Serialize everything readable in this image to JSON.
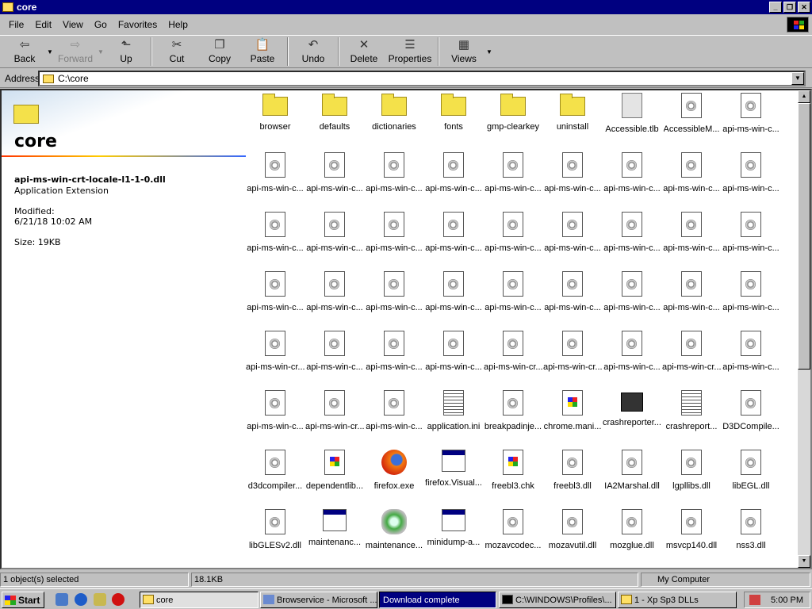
{
  "window": {
    "title": "core"
  },
  "menu": [
    "File",
    "Edit",
    "View",
    "Go",
    "Favorites",
    "Help"
  ],
  "toolbar": [
    {
      "label": "Back",
      "icon": "back-arrow-icon",
      "disabled": false
    },
    {
      "label": "Forward",
      "icon": "forward-arrow-icon",
      "disabled": true
    },
    {
      "label": "Up",
      "icon": "up-folder-icon",
      "disabled": false
    },
    {
      "label": "Cut",
      "icon": "scissors-icon",
      "disabled": false
    },
    {
      "label": "Copy",
      "icon": "copy-icon",
      "disabled": false
    },
    {
      "label": "Paste",
      "icon": "paste-icon",
      "disabled": false
    },
    {
      "label": "Undo",
      "icon": "undo-icon",
      "disabled": false
    },
    {
      "label": "Delete",
      "icon": "delete-icon",
      "disabled": false
    },
    {
      "label": "Properties",
      "icon": "properties-icon",
      "disabled": false
    },
    {
      "label": "Views",
      "icon": "views-icon",
      "disabled": false
    }
  ],
  "address": {
    "label": "Address",
    "value": "C:\\core"
  },
  "info_pane": {
    "folder_name": "core",
    "file_name": "api-ms-win-crt-locale-l1-1-0.dll",
    "file_type": "Application Extension",
    "modified_label": "Modified:",
    "modified_value": "6/21/18 10:02 AM",
    "size": "Size: 19KB"
  },
  "files": [
    {
      "name": "browser",
      "type": "folder"
    },
    {
      "name": "defaults",
      "type": "folder"
    },
    {
      "name": "dictionaries",
      "type": "folder"
    },
    {
      "name": "fonts",
      "type": "folder"
    },
    {
      "name": "gmp-clearkey",
      "type": "folder"
    },
    {
      "name": "uninstall",
      "type": "folder"
    },
    {
      "name": "Accessible.tlb",
      "type": "gen"
    },
    {
      "name": "AccessibleM...",
      "type": "dll"
    },
    {
      "name": "api-ms-win-c...",
      "type": "dll"
    },
    {
      "name": "api-ms-win-c...",
      "type": "dll"
    },
    {
      "name": "api-ms-win-c...",
      "type": "dll"
    },
    {
      "name": "api-ms-win-c...",
      "type": "dll"
    },
    {
      "name": "api-ms-win-c...",
      "type": "dll"
    },
    {
      "name": "api-ms-win-c...",
      "type": "dll"
    },
    {
      "name": "api-ms-win-c...",
      "type": "dll"
    },
    {
      "name": "api-ms-win-c...",
      "type": "dll"
    },
    {
      "name": "api-ms-win-c...",
      "type": "dll"
    },
    {
      "name": "api-ms-win-c...",
      "type": "dll"
    },
    {
      "name": "api-ms-win-c...",
      "type": "dll"
    },
    {
      "name": "api-ms-win-c...",
      "type": "dll"
    },
    {
      "name": "api-ms-win-c...",
      "type": "dll"
    },
    {
      "name": "api-ms-win-c...",
      "type": "dll"
    },
    {
      "name": "api-ms-win-c...",
      "type": "dll"
    },
    {
      "name": "api-ms-win-c...",
      "type": "dll"
    },
    {
      "name": "api-ms-win-c...",
      "type": "dll"
    },
    {
      "name": "api-ms-win-c...",
      "type": "dll"
    },
    {
      "name": "api-ms-win-c...",
      "type": "dll"
    },
    {
      "name": "api-ms-win-c...",
      "type": "dll"
    },
    {
      "name": "api-ms-win-c...",
      "type": "dll"
    },
    {
      "name": "api-ms-win-c...",
      "type": "dll"
    },
    {
      "name": "api-ms-win-c...",
      "type": "dll"
    },
    {
      "name": "api-ms-win-c...",
      "type": "dll"
    },
    {
      "name": "api-ms-win-c...",
      "type": "dll"
    },
    {
      "name": "api-ms-win-c...",
      "type": "dll"
    },
    {
      "name": "api-ms-win-c...",
      "type": "dll"
    },
    {
      "name": "api-ms-win-c...",
      "type": "dll"
    },
    {
      "name": "api-ms-win-cr...",
      "type": "dll"
    },
    {
      "name": "api-ms-win-c...",
      "type": "dll"
    },
    {
      "name": "api-ms-win-c...",
      "type": "dll"
    },
    {
      "name": "api-ms-win-c...",
      "type": "dll"
    },
    {
      "name": "api-ms-win-cr...",
      "type": "dll"
    },
    {
      "name": "api-ms-win-cr...",
      "type": "dll"
    },
    {
      "name": "api-ms-win-c...",
      "type": "dll"
    },
    {
      "name": "api-ms-win-cr...",
      "type": "dll"
    },
    {
      "name": "api-ms-win-c...",
      "type": "dll"
    },
    {
      "name": "api-ms-win-c...",
      "type": "dll"
    },
    {
      "name": "api-ms-win-cr...",
      "type": "dll"
    },
    {
      "name": "api-ms-win-c...",
      "type": "dll"
    },
    {
      "name": "application.ini",
      "type": "ini"
    },
    {
      "name": "breakpadinje...",
      "type": "dll"
    },
    {
      "name": "chrome.mani...",
      "type": "win"
    },
    {
      "name": "crashreporter...",
      "type": "crash"
    },
    {
      "name": "crashreport...",
      "type": "ini"
    },
    {
      "name": "D3DCompile...",
      "type": "dll"
    },
    {
      "name": "d3dcompiler...",
      "type": "dll"
    },
    {
      "name": "dependentlib...",
      "type": "win"
    },
    {
      "name": "firefox.exe",
      "type": "ff"
    },
    {
      "name": "firefox.Visual...",
      "type": "exe"
    },
    {
      "name": "freebl3.chk",
      "type": "win"
    },
    {
      "name": "freebl3.dll",
      "type": "dll"
    },
    {
      "name": "IA2Marshal.dll",
      "type": "dll"
    },
    {
      "name": "lgpllibs.dll",
      "type": "dll"
    },
    {
      "name": "libEGL.dll",
      "type": "dll"
    },
    {
      "name": "libGLESv2.dll",
      "type": "dll"
    },
    {
      "name": "maintenanc...",
      "type": "exe"
    },
    {
      "name": "maintenance...",
      "type": "maint"
    },
    {
      "name": "minidump-a...",
      "type": "exe"
    },
    {
      "name": "mozavcodec...",
      "type": "dll"
    },
    {
      "name": "mozavutil.dll",
      "type": "dll"
    },
    {
      "name": "mozglue.dll",
      "type": "dll"
    },
    {
      "name": "msvcp140.dll",
      "type": "dll"
    },
    {
      "name": "nss3.dll",
      "type": "dll"
    }
  ],
  "status": {
    "selected": "1 object(s) selected",
    "size": "18.1KB",
    "zone": "My Computer"
  },
  "taskbar": {
    "start": "Start",
    "tasks": [
      {
        "label": "core",
        "state": "pressed"
      },
      {
        "label": "Browservice - Microsoft ...",
        "state": "normal"
      },
      {
        "label": "Download complete",
        "state": "active"
      },
      {
        "label": "C:\\WINDOWS\\Profiles\\...",
        "state": "normal"
      },
      {
        "label": "1 - Xp Sp3 DLLs",
        "state": "normal"
      }
    ],
    "clock": "5:00 PM"
  }
}
